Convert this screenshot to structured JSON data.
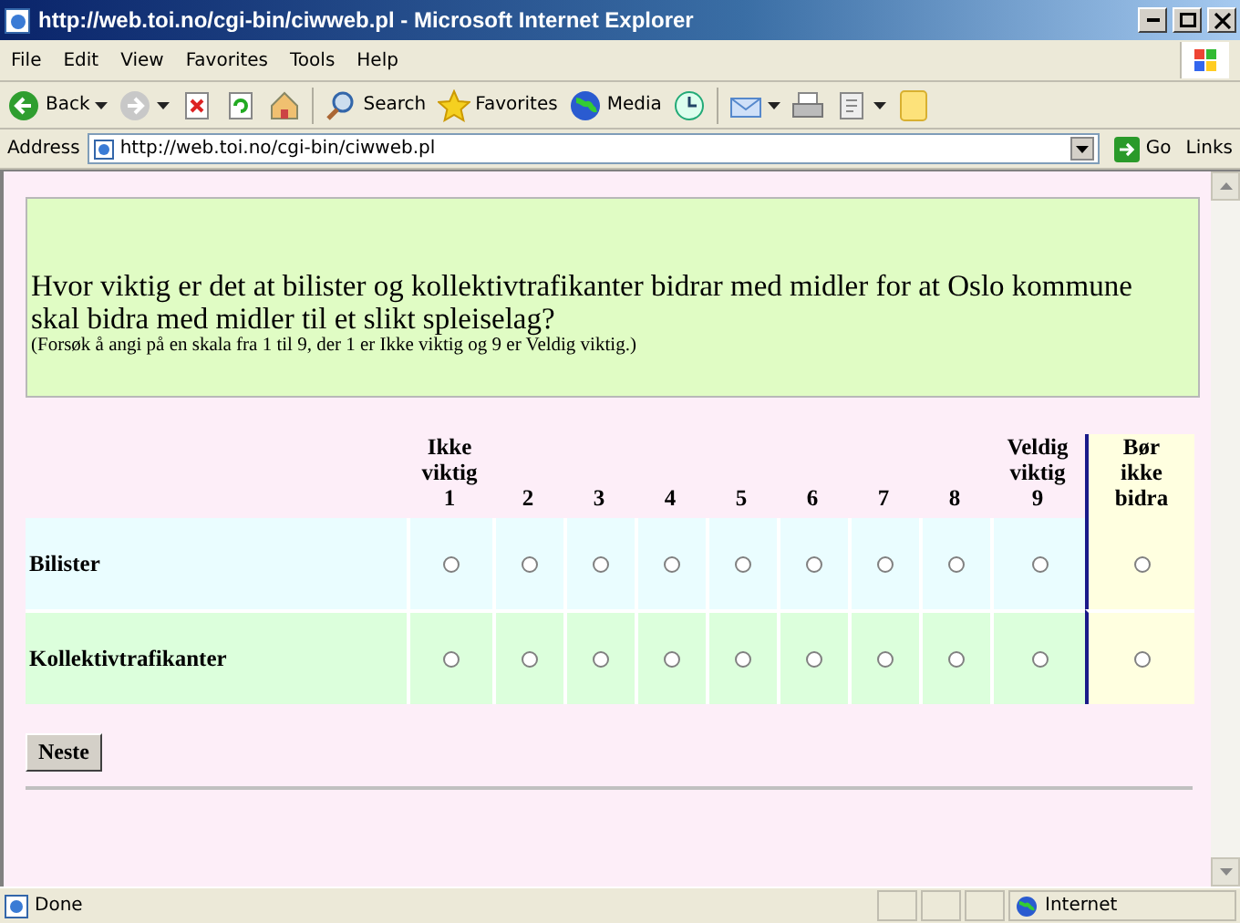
{
  "window": {
    "title": "http://web.toi.no/cgi-bin/ciwweb.pl - Microsoft Internet Explorer"
  },
  "menu": [
    "File",
    "Edit",
    "View",
    "Favorites",
    "Tools",
    "Help"
  ],
  "toolbar": [
    {
      "kind": "back",
      "label": "Back"
    },
    {
      "kind": "forward"
    },
    {
      "kind": "stop"
    },
    {
      "kind": "refresh"
    },
    {
      "kind": "home"
    },
    {
      "kind": "search",
      "label": "Search"
    },
    {
      "kind": "favorites",
      "label": "Favorites"
    },
    {
      "kind": "media",
      "label": "Media"
    },
    {
      "kind": "history"
    },
    {
      "kind": "mail"
    },
    {
      "kind": "print"
    },
    {
      "kind": "edit"
    },
    {
      "kind": "note"
    }
  ],
  "address_bar": {
    "label": "Address",
    "url": "http://web.toi.no/cgi-bin/ciwweb.pl",
    "go": "Go",
    "links": "Links"
  },
  "question": {
    "text": "Hvor viktig er det at bilister og kollektivtrafikanter bidrar med midler for at Oslo kommune skal bidra med midler til et slikt spleiselag?",
    "hint": "(Forsøk å angi på en skala fra 1 til 9, der 1 er Ikke viktig og 9 er Veldig viktig.)"
  },
  "columns": [
    {
      "label": "Ikke viktig",
      "number": "1",
      "kind": "scale"
    },
    {
      "number": "2",
      "kind": "scale"
    },
    {
      "number": "3",
      "kind": "scale"
    },
    {
      "number": "4",
      "kind": "scale"
    },
    {
      "number": "5",
      "kind": "scale"
    },
    {
      "number": "6",
      "kind": "scale"
    },
    {
      "number": "7",
      "kind": "scale"
    },
    {
      "number": "8",
      "kind": "scale"
    },
    {
      "label": "Veldig viktig",
      "number": "9",
      "kind": "scale"
    },
    {
      "label": "Bør ikke bidra",
      "kind": "opt-out"
    }
  ],
  "rows": [
    {
      "label": "Bilister",
      "options": [
        {
          "selected": false
        },
        {
          "selected": false
        },
        {
          "selected": false
        },
        {
          "selected": false
        },
        {
          "selected": false
        },
        {
          "selected": false
        },
        {
          "selected": false
        },
        {
          "selected": false
        },
        {
          "selected": false
        },
        {
          "selected": false
        }
      ]
    },
    {
      "label": "Kollektivtrafikanter",
      "options": [
        {
          "selected": false
        },
        {
          "selected": false
        },
        {
          "selected": false
        },
        {
          "selected": false
        },
        {
          "selected": false
        },
        {
          "selected": false
        },
        {
          "selected": false
        },
        {
          "selected": false
        },
        {
          "selected": false
        },
        {
          "selected": false
        }
      ]
    }
  ],
  "next_button": "Neste",
  "status_bar": {
    "text": "Done",
    "zone": "Internet"
  }
}
